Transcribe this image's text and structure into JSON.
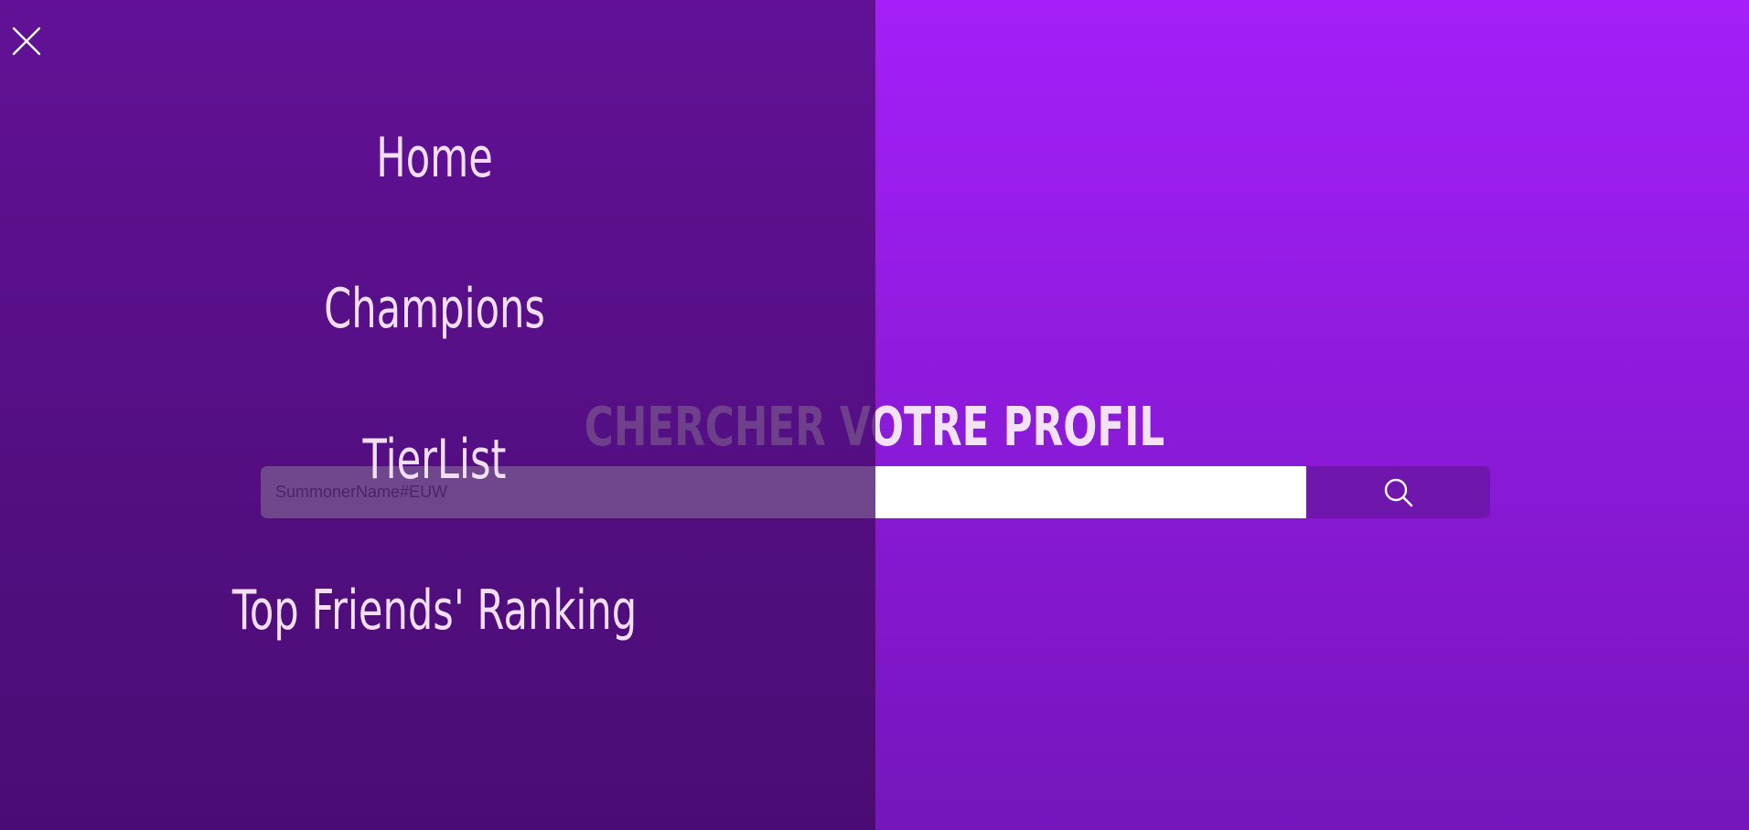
{
  "hero": {
    "title": "CHERCHER VOTRE PROFIL"
  },
  "search": {
    "placeholder": "SummonerName#EUW",
    "value": "",
    "button_icon": "search-icon"
  },
  "drawer": {
    "close_icon": "close-icon",
    "items": [
      {
        "label": "Home"
      },
      {
        "label": "Champions"
      },
      {
        "label": "TierList"
      },
      {
        "label": "Top Friends' Ranking"
      }
    ]
  },
  "colors": {
    "page_gradient_top": "#a41ff9",
    "page_gradient_bottom": "#7515bc",
    "drawer_overlay": "#4a0c73",
    "search_button": "#6f16ad",
    "text_light": "#f2dff6"
  }
}
